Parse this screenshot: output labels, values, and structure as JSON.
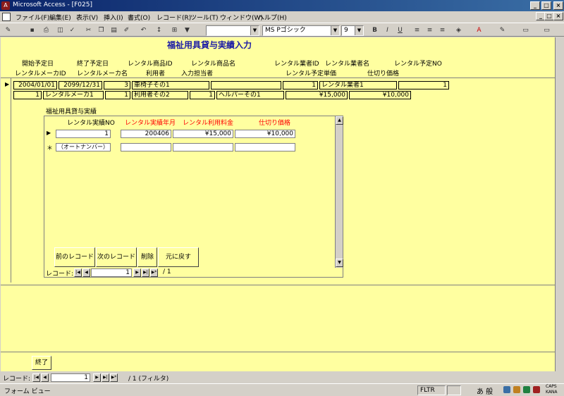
{
  "window": {
    "title": "Microsoft Access - [F025]"
  },
  "menu": [
    "ファイル(F)",
    "編集(E)",
    "表示(V)",
    "挿入(I)",
    "書式(O)",
    "レコード(R)",
    "ツール(T)",
    "ウィンドウ(W)",
    "ヘルプ(H)"
  ],
  "toolbar": {
    "font": "MS Pゴシック",
    "size": "9",
    "bold": "B",
    "italic": "I",
    "underline": "U"
  },
  "form": {
    "title": "福祉用具貸与実績入力",
    "labels1": [
      "開始予定日",
      "終了予定日",
      "レンタル商品ID",
      "レンタル商品名",
      "レンタル業者ID",
      "レンタル業者名",
      "レンタル予定NO"
    ],
    "labels2": [
      "レンタルメーカID",
      "レンタルメーカ名",
      "利用者",
      "入力担当者",
      "レンタル予定単価",
      "仕切り価格"
    ],
    "row1": {
      "start": "2004/01/01",
      "end": "2099/12/31",
      "product_id": "3",
      "product_name": "車椅子その1",
      "blank": "",
      "vendor_id": "1",
      "vendor_name": "レンタル業者1",
      "plan_no": "1"
    },
    "row2": {
      "maker_id": "1",
      "maker_name": "レンタルメーカ1",
      "user_id": "1",
      "user_name": "利用者その2",
      "staff_id": "1",
      "staff_name": "ヘルパーその1",
      "unit_price": "¥15,000",
      "cost": "¥10,000"
    },
    "subform_title": "福祉用具貸与実績",
    "sub_headers": [
      "レンタル実績NO",
      "レンタル実績年月",
      "レンタル利用料金",
      "仕切り価格"
    ],
    "sub_row": {
      "no": "1",
      "month": "200406",
      "fee": "¥15,000",
      "cost": "¥10,000"
    },
    "new_row": {
      "no": "（オートナンバー）"
    },
    "buttons": [
      "前のレコード",
      "次のレコード",
      "削除",
      "元に戻す"
    ],
    "sub_nav": {
      "label": "レコード:",
      "current": "1",
      "total": "/ 1"
    },
    "close_button": "終了"
  },
  "nav": {
    "label": "レコード:",
    "current": "1",
    "total": "/ 1 (フィルタ)"
  },
  "status": {
    "text": "フォーム ビュー",
    "fltr": "FLTR",
    "ime": "あ 般",
    "caps": "CAPS",
    "kana": "KANA"
  }
}
